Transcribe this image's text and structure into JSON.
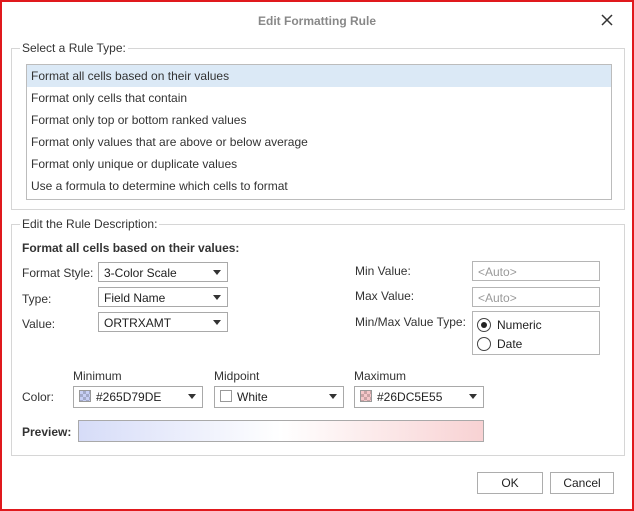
{
  "dialog": {
    "title": "Edit Formatting Rule"
  },
  "rule_type": {
    "group_label": "Select a Rule Type:",
    "items": [
      {
        "label": "Format all cells based on their values",
        "selected": true
      },
      {
        "label": "Format only cells that contain",
        "selected": false
      },
      {
        "label": "Format only top or bottom ranked values",
        "selected": false
      },
      {
        "label": "Format only values that are above or below average",
        "selected": false
      },
      {
        "label": "Format only unique or duplicate values",
        "selected": false
      },
      {
        "label": "Use a formula to determine which cells to format",
        "selected": false
      }
    ]
  },
  "description": {
    "group_label": "Edit the Rule Description:",
    "heading": "Format all cells based on their values:",
    "format_style_label": "Format Style:",
    "format_style_value": "3-Color Scale",
    "type_label": "Type:",
    "type_value": "Field Name",
    "value_label": "Value:",
    "value_value": "ORTRXAMT",
    "min_value_label": "Min Value:",
    "min_value_placeholder": "<Auto>",
    "max_value_label": "Max Value:",
    "max_value_placeholder": "<Auto>",
    "minmax_type_label": "Min/Max Value Type:",
    "radio_numeric": "Numeric",
    "radio_date": "Date",
    "radio_selected": "Numeric"
  },
  "colors": {
    "color_label": "Color:",
    "minimum_label": "Minimum",
    "midpoint_label": "Midpoint",
    "maximum_label": "Maximum",
    "minimum_value": "#265D79DE",
    "midpoint_value": "White",
    "maximum_value": "#26DC5E55",
    "minimum_swatch": "#c7cff5",
    "midpoint_swatch": "#ffffff",
    "maximum_swatch": "#f5c7c9"
  },
  "preview": {
    "label": "Preview:",
    "gradient_start": "#d6dcf8",
    "gradient_mid": "#ffffff",
    "gradient_end": "#f8d2d3"
  },
  "buttons": {
    "ok": "OK",
    "cancel": "Cancel"
  }
}
